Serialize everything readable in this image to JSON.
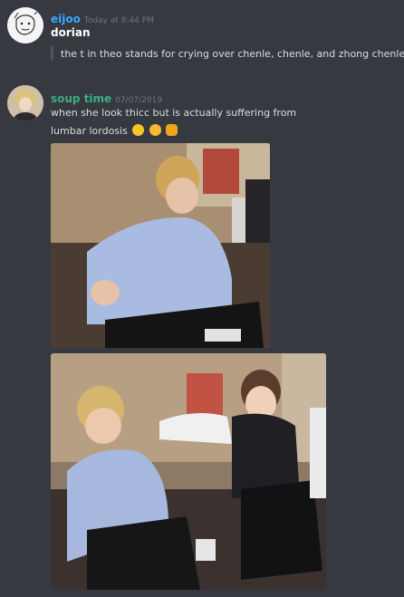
{
  "colors": {
    "background": "#36393f",
    "username_eijoo": "#3ba8ff",
    "username_soup": "#3aaf85",
    "timestamp": "#72767d",
    "text": "#dcddde"
  },
  "messages": [
    {
      "author": "eijoo",
      "timestamp": "Today at 8:44 PM",
      "first_line": "dorian",
      "quote": "the t in theo stands for crying over chenle, chenle, and zhong chenle"
    },
    {
      "author": "soup time",
      "timestamp": "07/07/2019",
      "lines": [
        "when she look thicc but is actually suffering from",
        "lumbar lordosis"
      ],
      "emojis": [
        "laughing-tongue-emoji",
        "pensive-emoji",
        "fist-bump-emoji"
      ]
    }
  ]
}
